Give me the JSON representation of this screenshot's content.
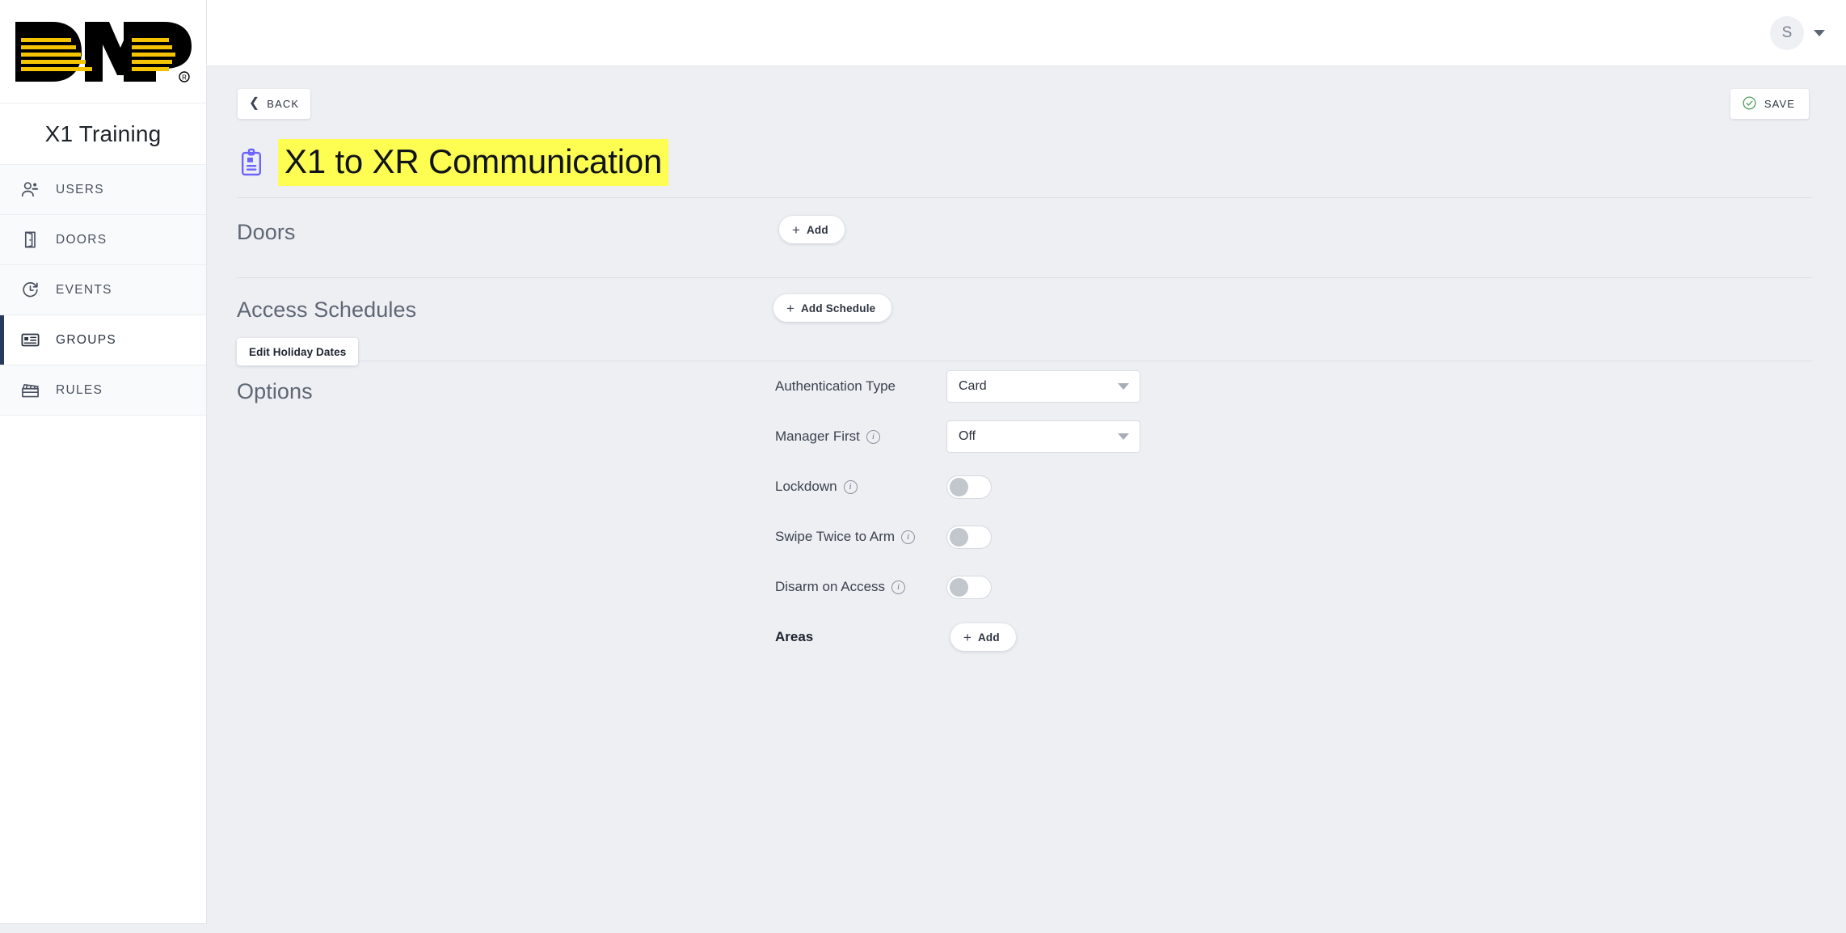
{
  "brand": {
    "logo_alt": "DMP",
    "org_name": "X1 Training"
  },
  "topbar": {
    "avatar_initial": "S",
    "caret_icon": "chevron-down-icon"
  },
  "toolbar": {
    "back_label": "BACK",
    "back_icon": "chevron-left-icon",
    "save_label": "SAVE",
    "save_icon": "check-circle-icon",
    "save_icon_color": "#4f9d5a"
  },
  "page": {
    "title": "X1 to XR Communication",
    "title_icon": "id-badge-icon",
    "title_icon_color": "#6c63ff",
    "title_highlight_color": "#fdfd52"
  },
  "sidebar": {
    "items": [
      {
        "label": "USERS",
        "icon": "users-icon",
        "active": false
      },
      {
        "label": "DOORS",
        "icon": "door-icon",
        "active": false
      },
      {
        "label": "EVENTS",
        "icon": "history-icon",
        "active": false
      },
      {
        "label": "GROUPS",
        "icon": "badge-card-icon",
        "active": true
      },
      {
        "label": "RULES",
        "icon": "clapperboard-icon",
        "active": false
      }
    ],
    "active_indicator_color": "#263a5c"
  },
  "sections": {
    "doors": {
      "title": "Doors",
      "add_label": "Add"
    },
    "access_schedules": {
      "title": "Access Schedules",
      "add_label": "Add Schedule",
      "edit_holiday_label": "Edit Holiday Dates"
    },
    "options": {
      "title": "Options",
      "fields": [
        {
          "label": "Authentication Type",
          "type": "select",
          "value": "Card",
          "has_info": false
        },
        {
          "label": "Manager First",
          "type": "select",
          "value": "Off",
          "has_info": true
        },
        {
          "label": "Lockdown",
          "type": "toggle",
          "value": "off",
          "has_info": true
        },
        {
          "label": "Swipe Twice to Arm",
          "type": "toggle",
          "value": "off",
          "has_info": true
        },
        {
          "label": "Disarm on Access",
          "type": "toggle",
          "value": "off",
          "has_info": true
        },
        {
          "label": "Areas",
          "type": "add",
          "value": "Add",
          "has_info": false
        }
      ]
    }
  },
  "colors": {
    "page_background": "#edeff3",
    "panel_white": "#ffffff",
    "divider": "#dcdfe5",
    "brand_yellow": "#f5c400",
    "accent_navy": "#263a5c"
  }
}
